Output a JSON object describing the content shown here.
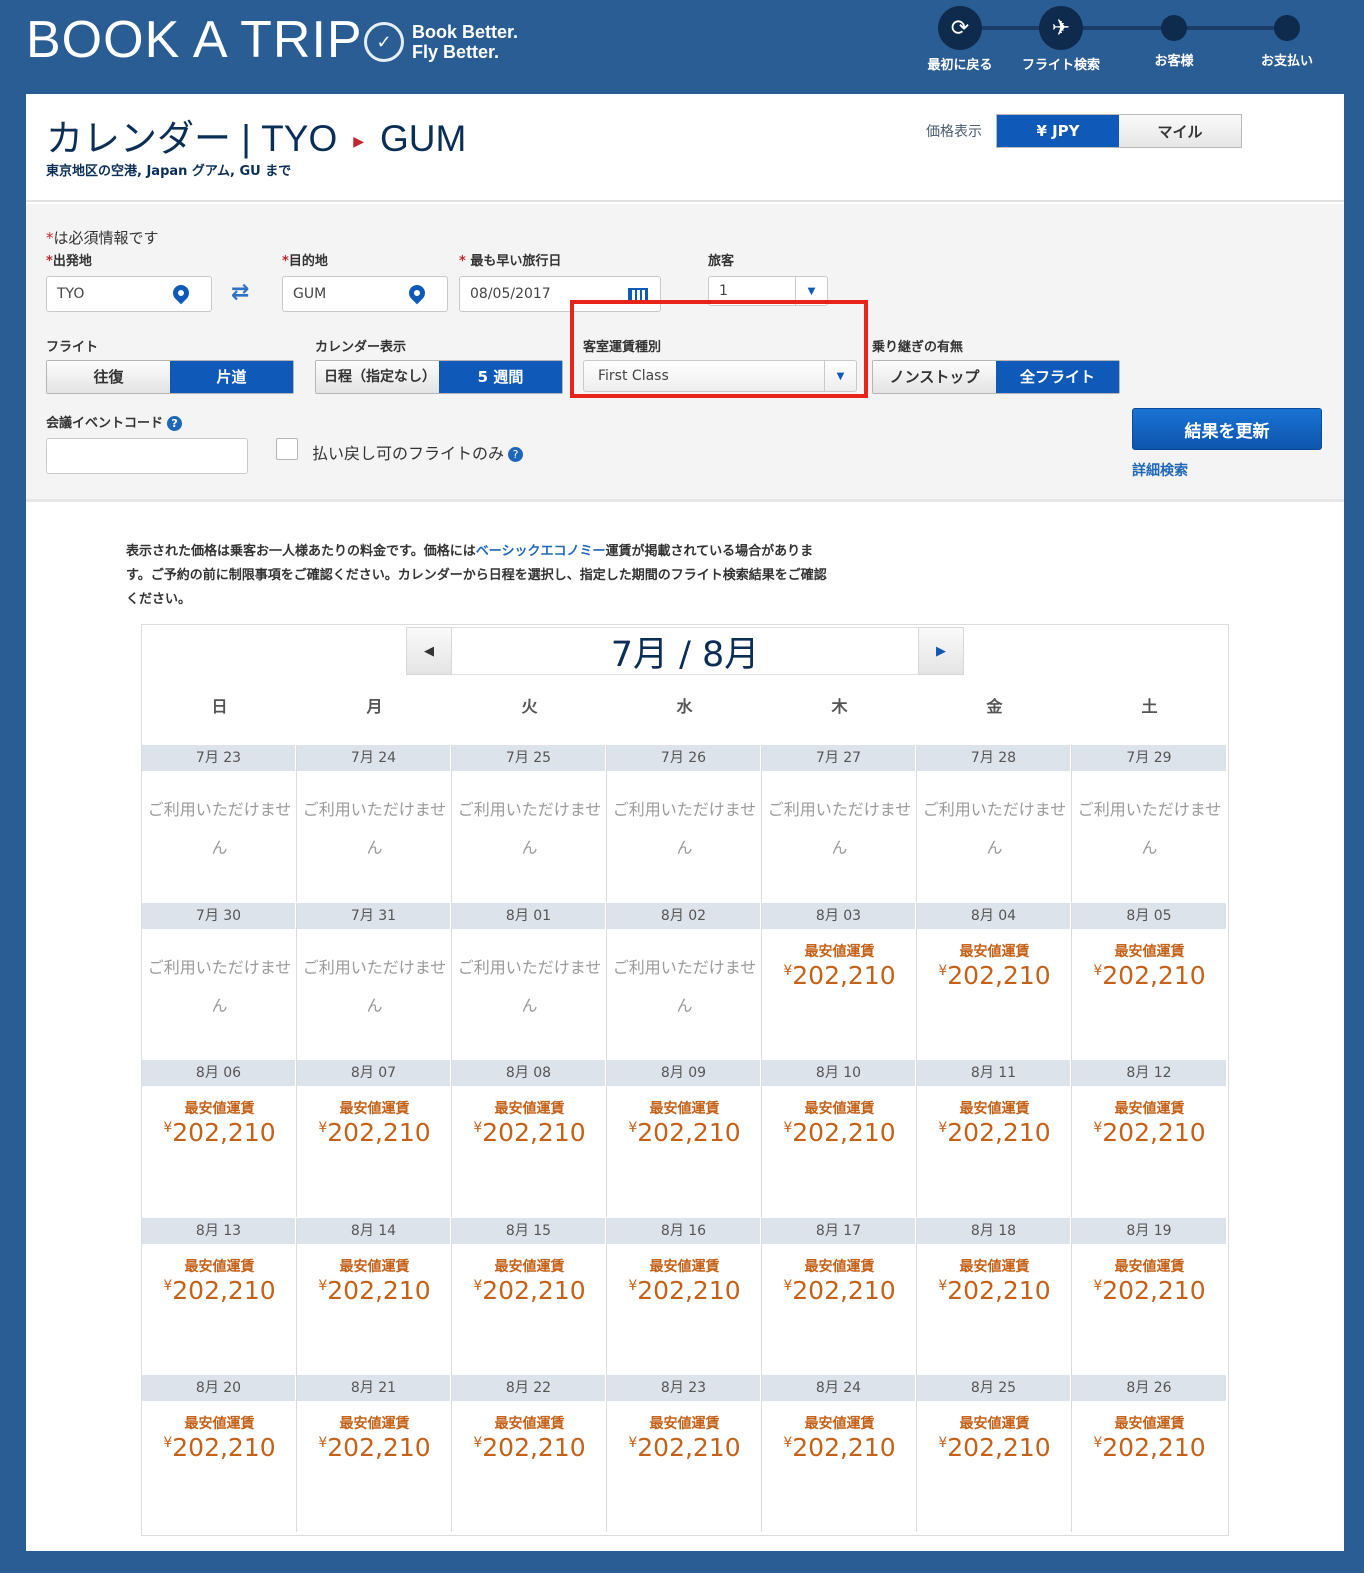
{
  "header": {
    "title": "BOOK A TRIP",
    "tagline_line1": "Book Better.",
    "tagline_line2": "Fly Better.",
    "steps": [
      {
        "label": "最初に戻る",
        "icon": "restart-icon"
      },
      {
        "label": "フライト検索",
        "icon": "airplane-icon"
      },
      {
        "label": "お客様",
        "icon": "step-dot"
      },
      {
        "label": "お支払い",
        "icon": "step-dot"
      }
    ]
  },
  "title": {
    "prefix": "カレンダー | TYO",
    "destination": "GUM",
    "subtitle": "東京地区の空港, Japan グアム, GU まで"
  },
  "price_display": {
    "label": "価格表示",
    "option_yen": "¥ JPY",
    "option_miles": "マイル",
    "selected": "¥ JPY"
  },
  "form": {
    "required_note": "は必須情報です",
    "origin_label": "出発地",
    "origin_value": "TYO",
    "dest_label": "目的地",
    "dest_value": "GUM",
    "date_label": "最も早い旅行日",
    "date_value": "08/05/2017",
    "pax_label": "旅客",
    "pax_value": "1",
    "flight_label": "フライト",
    "flight_rt": "往復",
    "flight_ow": "片道",
    "calview_label": "カレンダー表示",
    "calview_exact": "日程（指定なし）",
    "calview_5wk": "5 週間",
    "cabin_label": "客室運賃種別",
    "cabin_value": "First Class",
    "conn_label": "乗り継ぎの有無",
    "conn_nonstop": "ノンストップ",
    "conn_all": "全フライト",
    "event_label": "会議イベントコード",
    "refundable_label": "払い戻し可のフライトのみ",
    "update_button": "結果を更新",
    "advanced_link": "詳細検索"
  },
  "notice": {
    "part1": "表示された価格は乗客お一人様あたりの料金です。価格には",
    "link": "ベーシックエコノミー",
    "part2": "運賃が掲載されている場合があります。ご予約の前に制限事項をご確認ください。カレンダーから日程を選択し、指定した期間のフライト検索結果をご確認ください。"
  },
  "calendar": {
    "month": "7月 / 8月",
    "dow": [
      "日",
      "月",
      "火",
      "水",
      "木",
      "金",
      "土"
    ],
    "na_line1": "ご利用いただけませ",
    "na_line2": "ん",
    "fare_label": "最安値運賃",
    "currency": "¥",
    "weeks": [
      [
        {
          "d": "7月 23",
          "p": null
        },
        {
          "d": "7月 24",
          "p": null
        },
        {
          "d": "7月 25",
          "p": null
        },
        {
          "d": "7月 26",
          "p": null
        },
        {
          "d": "7月 27",
          "p": null
        },
        {
          "d": "7月 28",
          "p": null
        },
        {
          "d": "7月 29",
          "p": null
        }
      ],
      [
        {
          "d": "7月 30",
          "p": null
        },
        {
          "d": "7月 31",
          "p": null
        },
        {
          "d": "8月 01",
          "p": null
        },
        {
          "d": "8月 02",
          "p": null
        },
        {
          "d": "8月 03",
          "p": "202,210"
        },
        {
          "d": "8月 04",
          "p": "202,210"
        },
        {
          "d": "8月 05",
          "p": "202,210"
        }
      ],
      [
        {
          "d": "8月 06",
          "p": "202,210"
        },
        {
          "d": "8月 07",
          "p": "202,210"
        },
        {
          "d": "8月 08",
          "p": "202,210"
        },
        {
          "d": "8月 09",
          "p": "202,210"
        },
        {
          "d": "8月 10",
          "p": "202,210"
        },
        {
          "d": "8月 11",
          "p": "202,210"
        },
        {
          "d": "8月 12",
          "p": "202,210"
        }
      ],
      [
        {
          "d": "8月 13",
          "p": "202,210"
        },
        {
          "d": "8月 14",
          "p": "202,210"
        },
        {
          "d": "8月 15",
          "p": "202,210"
        },
        {
          "d": "8月 16",
          "p": "202,210"
        },
        {
          "d": "8月 17",
          "p": "202,210"
        },
        {
          "d": "8月 18",
          "p": "202,210"
        },
        {
          "d": "8月 19",
          "p": "202,210"
        }
      ],
      [
        {
          "d": "8月 20",
          "p": "202,210"
        },
        {
          "d": "8月 21",
          "p": "202,210"
        },
        {
          "d": "8月 22",
          "p": "202,210"
        },
        {
          "d": "8月 23",
          "p": "202,210"
        },
        {
          "d": "8月 24",
          "p": "202,210"
        },
        {
          "d": "8月 25",
          "p": "202,210"
        },
        {
          "d": "8月 26",
          "p": "202,210"
        }
      ]
    ]
  },
  "colors": {
    "brand_blue": "#2a5d94",
    "accent": "#0f5ab8",
    "fare": "#c4621a",
    "highlight": "#e8231a"
  }
}
